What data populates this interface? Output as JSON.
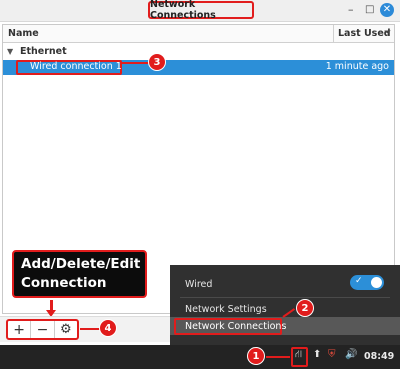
{
  "window": {
    "title": "Network Connections",
    "minimize_glyph": "–",
    "maximize_glyph": "□",
    "close_glyph": "✕"
  },
  "list": {
    "columns": {
      "name": "Name",
      "last_used": "Last Used"
    },
    "sort_icon_glyph": "⏷",
    "groups": [
      {
        "toggle_glyph": "▼",
        "label": "Ethernet",
        "connections": [
          {
            "name": "Wired connection 1",
            "last_used": "1 minute ago"
          }
        ]
      }
    ]
  },
  "toolbar": {
    "add_glyph": "+",
    "remove_glyph": "−",
    "settings_glyph": "⚙"
  },
  "callout": {
    "line1": "Add/Delete/Edit",
    "line2": "Connection"
  },
  "markers": [
    "1",
    "2",
    "3",
    "4"
  ],
  "network_menu": {
    "wired_label": "Wired",
    "wired_enabled": true,
    "toggle_check": "✓",
    "settings_label": "Network Settings",
    "connections_label": "Network Connections"
  },
  "taskbar": {
    "clock": "08:49",
    "icons": [
      "network-icon",
      "update-icon",
      "shield-icon",
      "volume-icon"
    ]
  },
  "colors": {
    "accent": "#2c8fd8",
    "annotation_red": "#e11c1c",
    "menu_bg": "#303030",
    "taskbar_bg": "#232323"
  }
}
